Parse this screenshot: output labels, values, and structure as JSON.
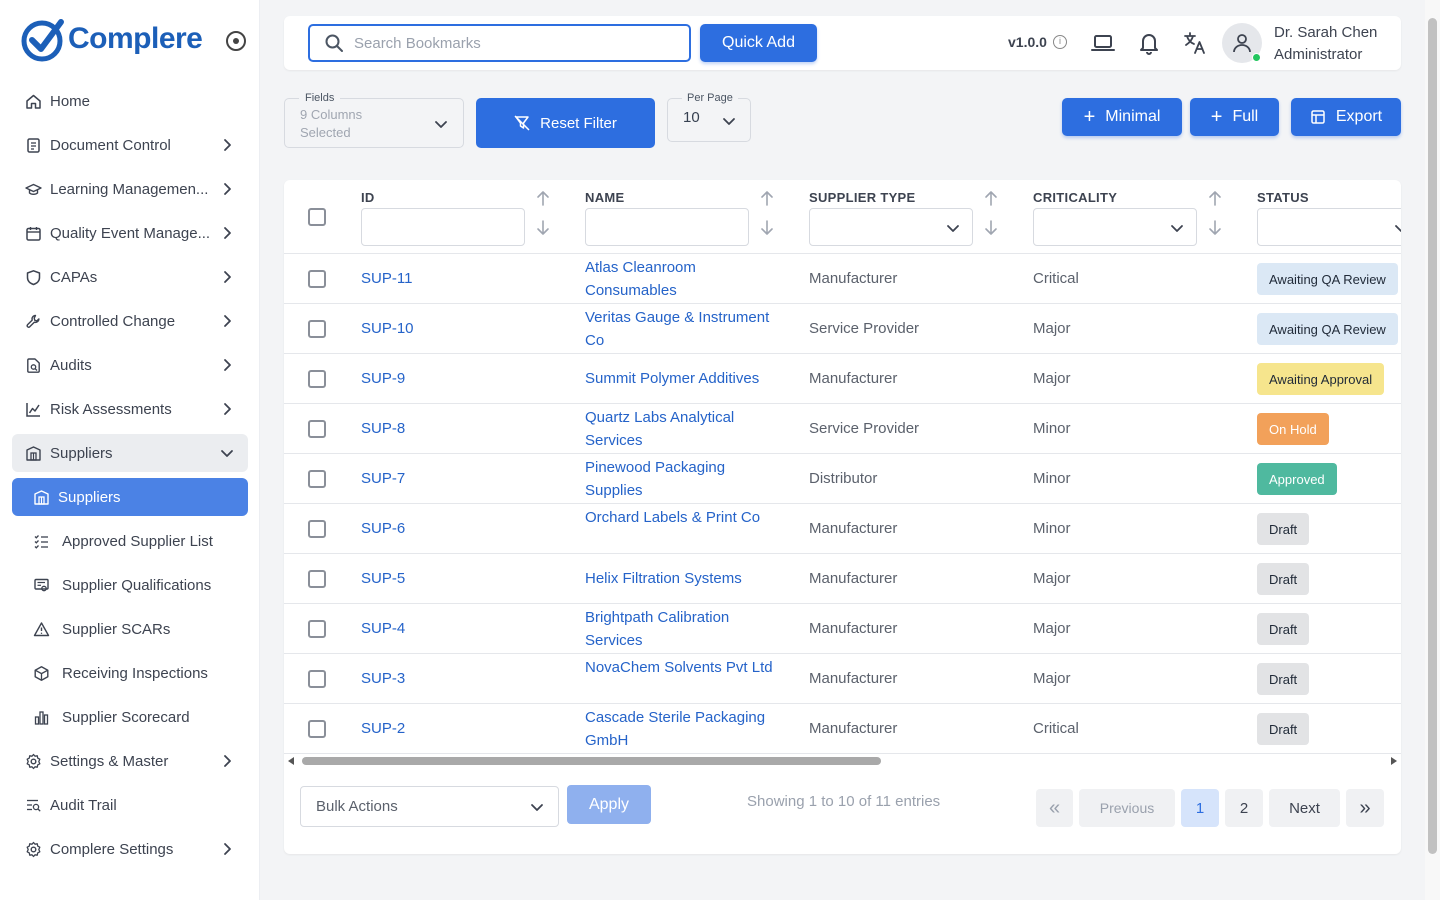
{
  "brand": {
    "name": "Complere",
    "color": "#1c5fb8"
  },
  "sidebar": {
    "items": [
      {
        "label": "Home",
        "icon": "home-icon",
        "chevron": false
      },
      {
        "label": "Document Control",
        "icon": "document-icon",
        "chevron": true
      },
      {
        "label": "Learning Managemen...",
        "icon": "graduation-cap-icon",
        "chevron": true
      },
      {
        "label": "Quality Event Manage...",
        "icon": "calendar-icon",
        "chevron": true
      },
      {
        "label": "CAPAs",
        "icon": "shield-icon",
        "chevron": true
      },
      {
        "label": "Controlled Change",
        "icon": "wrench-icon",
        "chevron": true
      },
      {
        "label": "Audits",
        "icon": "file-search-icon",
        "chevron": true
      },
      {
        "label": "Risk Assessments",
        "icon": "chart-icon",
        "chevron": true
      },
      {
        "label": "Suppliers",
        "icon": "building-icon",
        "chevron": true,
        "open": true
      }
    ],
    "sub_items": [
      {
        "label": "Suppliers",
        "icon": "building-icon",
        "active": true
      },
      {
        "label": "Approved Supplier List",
        "icon": "list-check-icon"
      },
      {
        "label": "Supplier Qualifications",
        "icon": "certificate-icon"
      },
      {
        "label": "Supplier SCARs",
        "icon": "warning-icon"
      },
      {
        "label": "Receiving Inspections",
        "icon": "package-icon"
      },
      {
        "label": "Supplier Scorecard",
        "icon": "bar-chart-icon"
      }
    ],
    "bottom_items": [
      {
        "label": "Settings & Master",
        "icon": "gear-icon",
        "chevron": true
      },
      {
        "label": "Audit Trail",
        "icon": "list-search-icon",
        "chevron": false
      },
      {
        "label": "Complere Settings",
        "icon": "gear-icon",
        "chevron": true
      }
    ]
  },
  "topbar": {
    "search_placeholder": "Search Bookmarks",
    "quick_add": "Quick Add",
    "version": "v1.0.0",
    "user_name": "Dr. Sarah Chen",
    "user_role": "Administrator"
  },
  "filters": {
    "fields_label": "Fields",
    "fields_value": "9 Columns Selected",
    "reset": "Reset Filter",
    "per_page_label": "Per Page",
    "per_page_value": "10",
    "minimal": "Minimal",
    "full": "Full",
    "export": "Export"
  },
  "table": {
    "columns": [
      "ID",
      "NAME",
      "SUPPLIER TYPE",
      "CRITICALITY",
      "STATUS"
    ],
    "rows": [
      {
        "id": "SUP-11",
        "name": "Atlas Cleanroom Consumables",
        "type": "Manufacturer",
        "criticality": "Critical",
        "status": "Awaiting QA Review",
        "status_kind": "qa"
      },
      {
        "id": "SUP-10",
        "name": "Veritas Gauge & Instrument Co",
        "type": "Service Provider",
        "criticality": "Major",
        "status": "Awaiting QA Review",
        "status_kind": "qa"
      },
      {
        "id": "SUP-9",
        "name": "Summit Polymer Additives",
        "type": "Manufacturer",
        "criticality": "Major",
        "status": "Awaiting Approval",
        "status_kind": "approval"
      },
      {
        "id": "SUP-8",
        "name": "Quartz Labs Analytical Services",
        "type": "Service Provider",
        "criticality": "Minor",
        "status": "On Hold",
        "status_kind": "hold"
      },
      {
        "id": "SUP-7",
        "name": "Pinewood Packaging Supplies",
        "type": "Distributor",
        "criticality": "Minor",
        "status": "Approved",
        "status_kind": "approved"
      },
      {
        "id": "SUP-6",
        "name": "Orchard Labels & Print Co",
        "type": "Manufacturer",
        "criticality": "Minor",
        "status": "Draft",
        "status_kind": "draft"
      },
      {
        "id": "SUP-5",
        "name": "Helix Filtration Systems",
        "type": "Manufacturer",
        "criticality": "Major",
        "status": "Draft",
        "status_kind": "draft"
      },
      {
        "id": "SUP-4",
        "name": "Brightpath Calibration Services",
        "type": "Manufacturer",
        "criticality": "Major",
        "status": "Draft",
        "status_kind": "draft"
      },
      {
        "id": "SUP-3",
        "name": "NovaChem Solvents Pvt Ltd",
        "type": "Manufacturer",
        "criticality": "Major",
        "status": "Draft",
        "status_kind": "draft"
      },
      {
        "id": "SUP-2",
        "name": "Cascade Sterile Packaging GmbH",
        "type": "Manufacturer",
        "criticality": "Critical",
        "status": "Draft",
        "status_kind": "draft"
      }
    ]
  },
  "status_colors": {
    "qa": {
      "bg": "#dbe8f5",
      "fg": "#1f2937"
    },
    "approval": {
      "bg": "#f6e58d",
      "fg": "#1f2937"
    },
    "hold": {
      "bg": "#f2a15a",
      "fg": "#ffffff"
    },
    "approved": {
      "bg": "#4fb99f",
      "fg": "#ffffff"
    },
    "draft": {
      "bg": "#e2e3e5",
      "fg": "#1f2937"
    }
  },
  "footer": {
    "bulk_actions": "Bulk Actions",
    "apply": "Apply",
    "showing": "Showing 1 to 10 of 11 entries",
    "first": "«",
    "previous": "Previous",
    "pages": [
      "1",
      "2"
    ],
    "current_page": "1",
    "next": "Next",
    "last": "»"
  },
  "colors": {
    "accent": "#2d6ee0",
    "active_nav": "#4b82e5",
    "link": "#2563c9"
  }
}
